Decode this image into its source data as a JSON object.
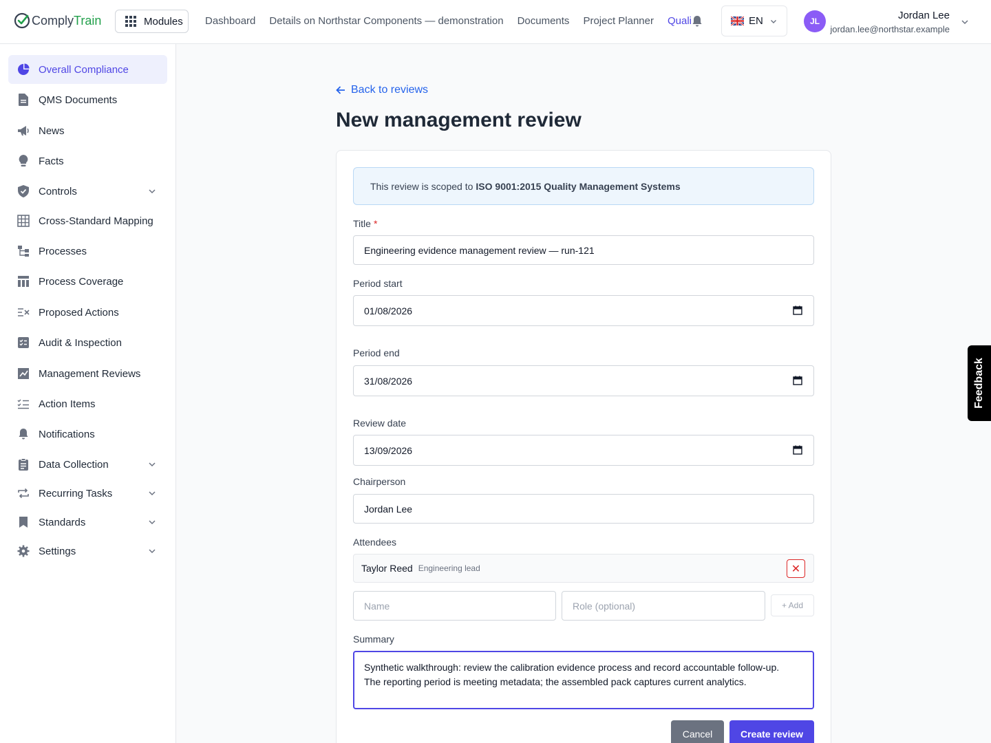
{
  "header": {
    "logo_main": "Comply",
    "logo_accent": "Train",
    "modules_label": "Modules",
    "nav": [
      "Dashboard",
      "Details on Northstar Components — demonstration",
      "Documents",
      "Project Planner",
      "Quali"
    ],
    "language": "EN",
    "avatar_initials": "JL",
    "user_name": "Jordan Lee",
    "user_email": "jordan.lee@northstar.example"
  },
  "sidebar": {
    "items": [
      {
        "label": "Overall Compliance",
        "icon": "pie-chart-icon"
      },
      {
        "label": "QMS Documents",
        "icon": "document-icon"
      },
      {
        "label": "News",
        "icon": "megaphone-icon"
      },
      {
        "label": "Facts",
        "icon": "lightbulb-icon"
      },
      {
        "label": "Controls",
        "icon": "shield-icon"
      },
      {
        "label": "Cross-Standard Mapping",
        "icon": "table-grid-icon"
      },
      {
        "label": "Processes",
        "icon": "hierarchy-icon"
      },
      {
        "label": "Process Coverage",
        "icon": "columns-icon"
      },
      {
        "label": "Proposed Actions",
        "icon": "list-x-icon"
      },
      {
        "label": "Audit & Inspection",
        "icon": "clipboard-icon"
      },
      {
        "label": "Management Reviews",
        "icon": "chart-edit-icon"
      },
      {
        "label": "Action Items",
        "icon": "checklist-icon"
      },
      {
        "label": "Notifications",
        "icon": "bell-icon"
      },
      {
        "label": "Data Collection",
        "icon": "clipboard-list-icon"
      },
      {
        "label": "Recurring Tasks",
        "icon": "repeat-icon"
      },
      {
        "label": "Standards",
        "icon": "bookmark-icon"
      },
      {
        "label": "Settings",
        "icon": "gear-icon"
      }
    ]
  },
  "main": {
    "back_label": "Back to reviews",
    "title": "New management review",
    "scope_prefix": "This review is scoped to",
    "scope_standard": "ISO 9001:2015 Quality Management Systems",
    "title_label": "Title",
    "required_mark": "*",
    "title_value": "Engineering evidence management review — run-121",
    "period_start_label": "Period start",
    "period_start_value": "01/08/2026",
    "period_end_label": "Period end",
    "period_end_value": "31/08/2026",
    "review_date_label": "Review date",
    "review_date_value": "13/09/2026",
    "chair_label": "Chairperson",
    "chair_value": "Jordan Lee",
    "attendees_label": "Attendees",
    "attendee_name": "Taylor Reed",
    "attendee_role": "Engineering lead",
    "remove_glyph": "✕",
    "name_placeholder": "Name",
    "role_placeholder": "Role (optional)",
    "add_label": "+ Add",
    "summary_label": "Summary",
    "summary_value": "Synthetic walkthrough: review the calibration evidence process and record accountable follow-up.\nThe reporting period is meeting metadata; the assembled pack captures current analytics.",
    "cancel_label": "Cancel",
    "create_label": "Create review"
  },
  "feedback_label": "Feedback",
  "colors": {
    "accent": "#4f46e5",
    "link": "#2563eb",
    "danger": "#dc2626",
    "brand_green": "#22a04b"
  }
}
